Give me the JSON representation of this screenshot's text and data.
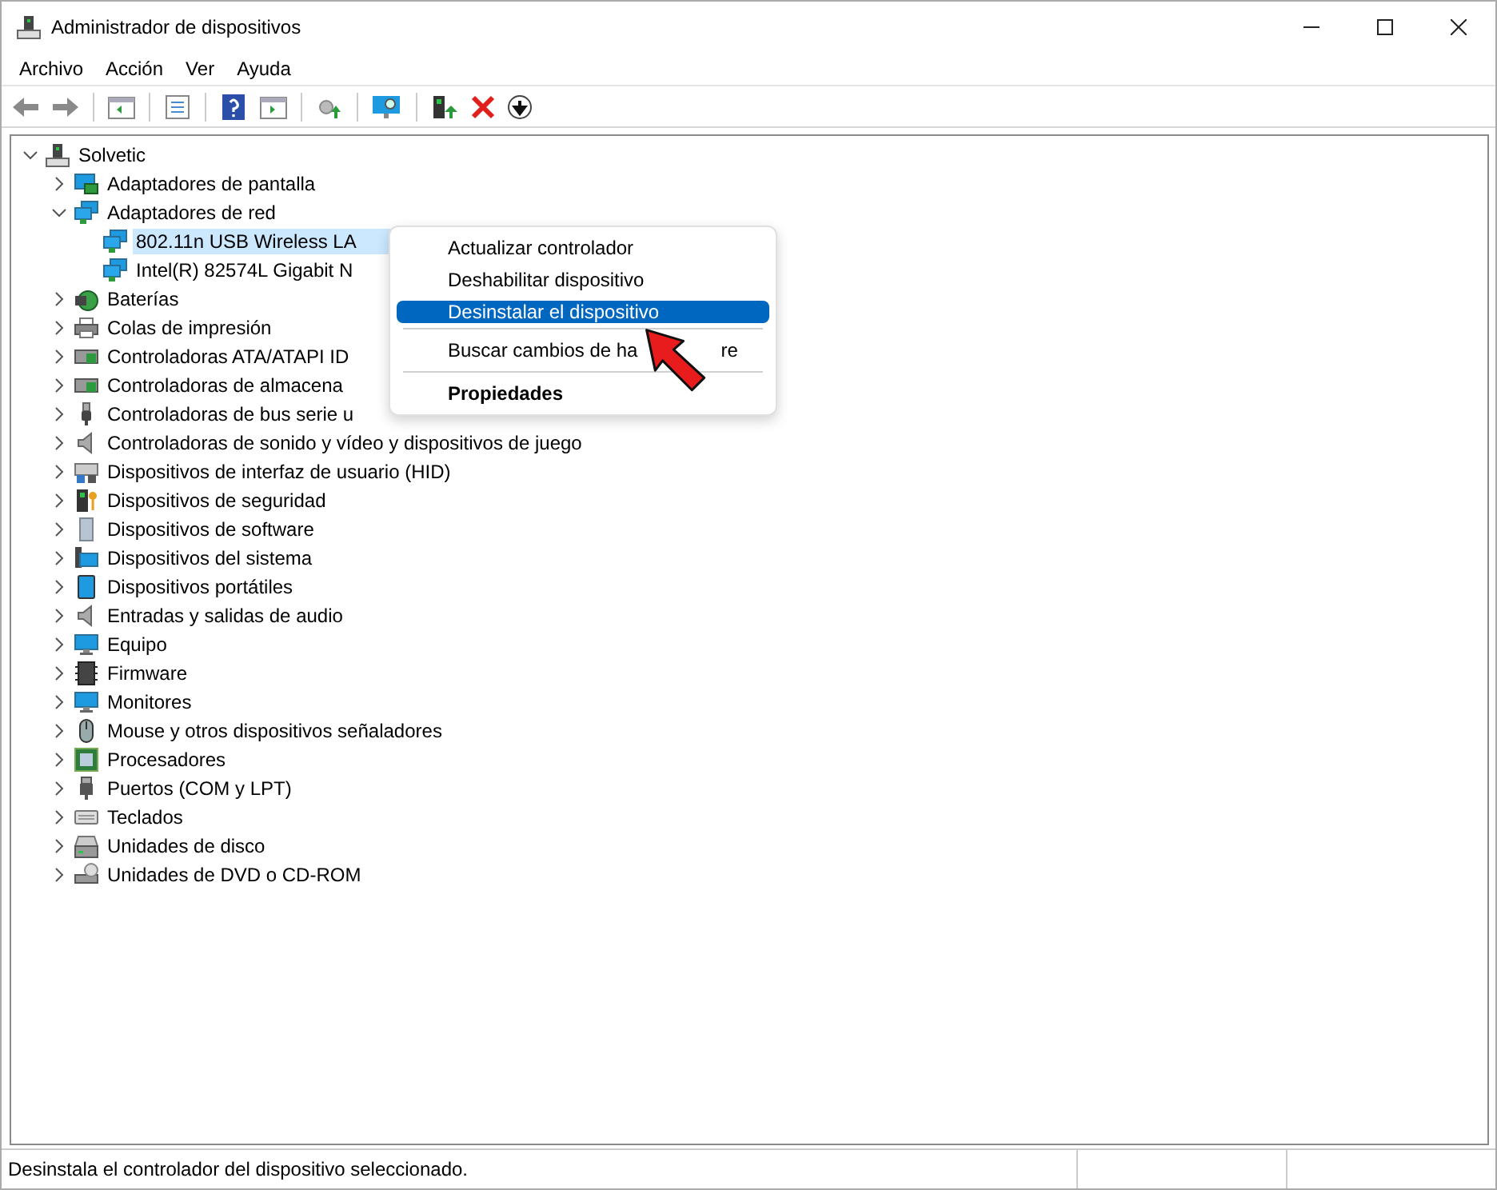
{
  "window": {
    "title": "Administrador de dispositivos"
  },
  "menu": [
    "Archivo",
    "Acción",
    "Ver",
    "Ayuda"
  ],
  "tree": {
    "label": "Solvetic",
    "expanded": true,
    "selected": false,
    "children": [
      {
        "label": "Adaptadores de pantalla",
        "expanded": false,
        "selected": false
      },
      {
        "label": "Adaptadores de red",
        "expanded": true,
        "selected": false,
        "children": [
          {
            "label": "802.11n USB Wireless LA",
            "selected": true
          },
          {
            "label": "Intel(R) 82574L Gigabit N",
            "selected": false
          }
        ]
      },
      {
        "label": "Baterías",
        "expanded": false,
        "selected": false
      },
      {
        "label": "Colas de impresión",
        "expanded": false,
        "selected": false
      },
      {
        "label": "Controladoras ATA/ATAPI ID",
        "expanded": false,
        "selected": false
      },
      {
        "label": "Controladoras de almacena",
        "expanded": false,
        "selected": false
      },
      {
        "label": "Controladoras de bus serie u",
        "expanded": false,
        "selected": false
      },
      {
        "label": "Controladoras de sonido y vídeo y dispositivos de juego",
        "expanded": false,
        "selected": false
      },
      {
        "label": "Dispositivos de interfaz de usuario (HID)",
        "expanded": false,
        "selected": false
      },
      {
        "label": "Dispositivos de seguridad",
        "expanded": false,
        "selected": false
      },
      {
        "label": "Dispositivos de software",
        "expanded": false,
        "selected": false
      },
      {
        "label": "Dispositivos del sistema",
        "expanded": false,
        "selected": false
      },
      {
        "label": "Dispositivos portátiles",
        "expanded": false,
        "selected": false
      },
      {
        "label": "Entradas y salidas de audio",
        "expanded": false,
        "selected": false
      },
      {
        "label": "Equipo",
        "expanded": false,
        "selected": false
      },
      {
        "label": "Firmware",
        "expanded": false,
        "selected": false
      },
      {
        "label": "Monitores",
        "expanded": false,
        "selected": false
      },
      {
        "label": "Mouse y otros dispositivos señaladores",
        "expanded": false,
        "selected": false
      },
      {
        "label": "Procesadores",
        "expanded": false,
        "selected": false
      },
      {
        "label": "Puertos (COM y LPT)",
        "expanded": false,
        "selected": false
      },
      {
        "label": "Teclados",
        "expanded": false,
        "selected": false
      },
      {
        "label": "Unidades de disco",
        "expanded": false,
        "selected": false
      },
      {
        "label": "Unidades de DVD o CD-ROM",
        "expanded": false,
        "selected": false
      }
    ]
  },
  "context_menu": [
    {
      "kind": "item",
      "label": "Actualizar controlador",
      "selected": false,
      "bold": false
    },
    {
      "kind": "item",
      "label": "Deshabilitar dispositivo",
      "selected": false,
      "bold": false
    },
    {
      "kind": "item",
      "label": "Desinstalar el dispositivo",
      "selected": true,
      "bold": false
    },
    {
      "kind": "separator"
    },
    {
      "kind": "item",
      "label": "Buscar cambios de ha",
      "label_tail": "re",
      "selected": false,
      "bold": false
    },
    {
      "kind": "separator"
    },
    {
      "kind": "item",
      "label": "Propiedades",
      "selected": false,
      "bold": true
    }
  ],
  "status_bar": {
    "text": "Desinstala el controlador del dispositivo seleccionado."
  }
}
